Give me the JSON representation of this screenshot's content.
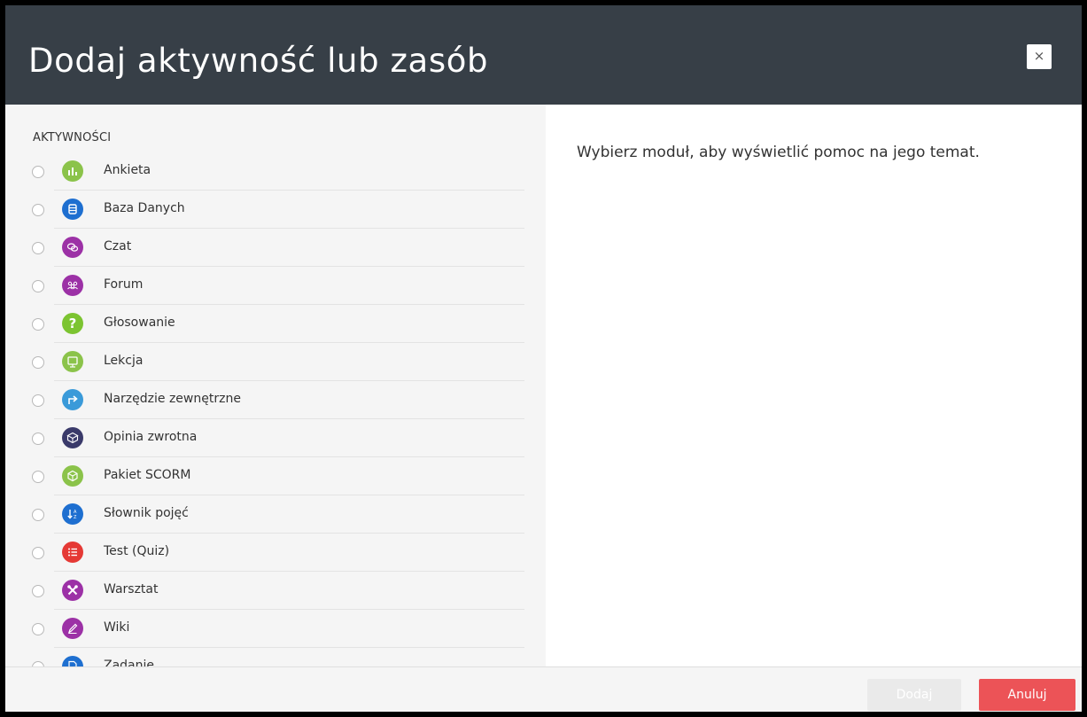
{
  "dialog": {
    "title": "Dodaj aktywność lub zasób",
    "close_label": "×"
  },
  "activities": {
    "section_label": "AKTYWNOŚCI",
    "items": [
      {
        "label": "Ankieta",
        "icon": "survey-icon",
        "color": "#8bc34a"
      },
      {
        "label": "Baza Danych",
        "icon": "database-icon",
        "color": "#1e6fd0"
      },
      {
        "label": "Czat",
        "icon": "chat-icon",
        "color": "#9c31a6"
      },
      {
        "label": "Forum",
        "icon": "forum-icon",
        "color": "#9c31a6"
      },
      {
        "label": "Głosowanie",
        "icon": "question-icon",
        "color": "#7cc431",
        "glyph": "?"
      },
      {
        "label": "Lekcja",
        "icon": "lesson-icon",
        "color": "#8bc34a"
      },
      {
        "label": "Narzędzie zewnętrzne",
        "icon": "external-tool-icon",
        "color": "#3a9ad9"
      },
      {
        "label": "Opinia zwrotna",
        "icon": "feedback-icon",
        "color": "#3a3a6a"
      },
      {
        "label": "Pakiet SCORM",
        "icon": "scorm-icon",
        "color": "#8bc34a"
      },
      {
        "label": "Słownik pojęć",
        "icon": "glossary-icon",
        "color": "#1e6fd0"
      },
      {
        "label": "Test (Quiz)",
        "icon": "quiz-icon",
        "color": "#e53935"
      },
      {
        "label": "Warsztat",
        "icon": "workshop-icon",
        "color": "#9c31a6"
      },
      {
        "label": "Wiki",
        "icon": "wiki-icon",
        "color": "#9c31a6"
      },
      {
        "label": "Zadanie",
        "icon": "assignment-icon",
        "color": "#1e6fd0"
      }
    ]
  },
  "help": {
    "text": "Wybierz moduł, aby wyświetlić pomoc na jego temat."
  },
  "footer": {
    "add_label": "Dodaj",
    "cancel_label": "Anuluj"
  }
}
